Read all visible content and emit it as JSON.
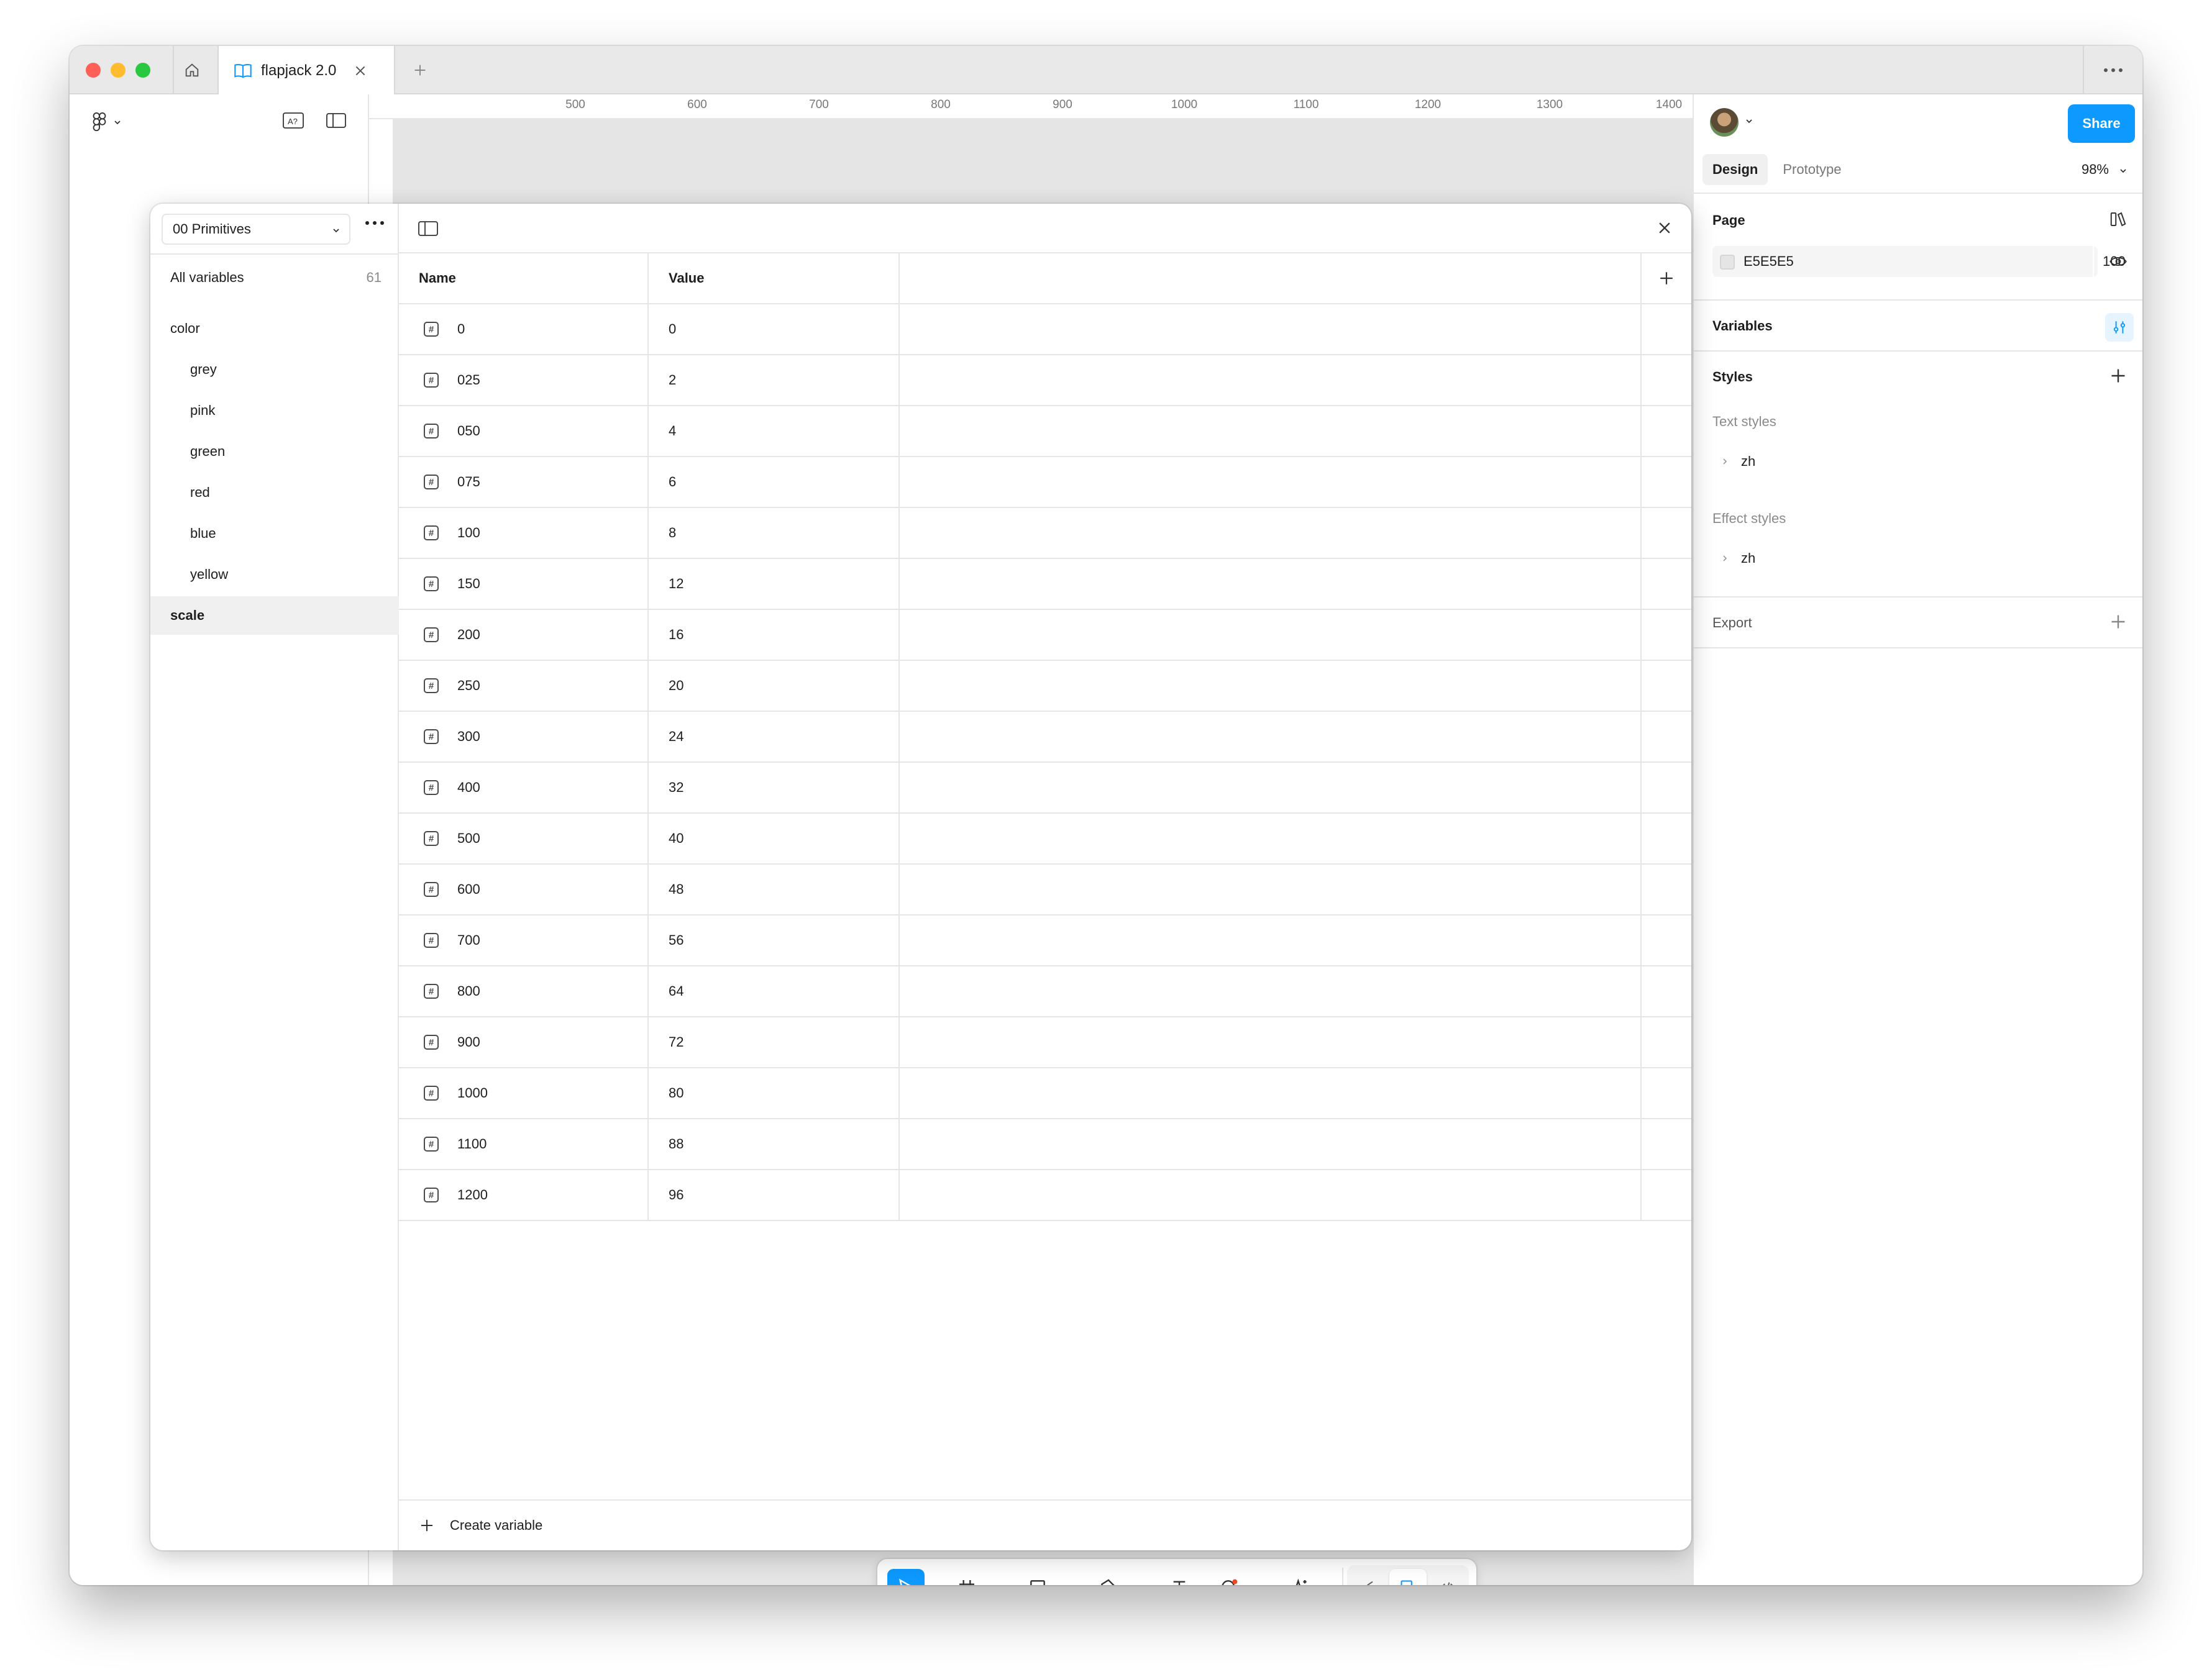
{
  "window": {
    "tab_title": "flapjack 2.0"
  },
  "ruler": {
    "ticks": [
      "500",
      "600",
      "700",
      "800",
      "900",
      "1000",
      "1100",
      "1200",
      "1300",
      "1400"
    ]
  },
  "right_panel": {
    "share_label": "Share",
    "tabs": [
      "Design",
      "Prototype"
    ],
    "zoom": "98%",
    "page_title": "Page",
    "page_color_hex": "E5E5E5",
    "page_opacity": "100",
    "page_opacity_unit": "%",
    "variables_title": "Variables",
    "styles_title": "Styles",
    "text_styles_label": "Text styles",
    "text_style_item": "zh",
    "effect_styles_label": "Effect styles",
    "effect_style_item": "zh",
    "export_title": "Export"
  },
  "help_label": "?",
  "variables_modal": {
    "collection": "00 Primitives",
    "all_variables_label": "All variables",
    "all_variables_count": "61",
    "groups": [
      "color",
      "grey",
      "pink",
      "green",
      "red",
      "blue",
      "yellow",
      "scale"
    ],
    "selected_group": "scale",
    "columns": [
      "Name",
      "Value"
    ],
    "rows": [
      {
        "name": "0",
        "value": "0"
      },
      {
        "name": "025",
        "value": "2"
      },
      {
        "name": "050",
        "value": "4"
      },
      {
        "name": "075",
        "value": "6"
      },
      {
        "name": "100",
        "value": "8"
      },
      {
        "name": "150",
        "value": "12"
      },
      {
        "name": "200",
        "value": "16"
      },
      {
        "name": "250",
        "value": "20"
      },
      {
        "name": "300",
        "value": "24"
      },
      {
        "name": "400",
        "value": "32"
      },
      {
        "name": "500",
        "value": "40"
      },
      {
        "name": "600",
        "value": "48"
      },
      {
        "name": "700",
        "value": "56"
      },
      {
        "name": "800",
        "value": "64"
      },
      {
        "name": "900",
        "value": "72"
      },
      {
        "name": "1000",
        "value": "80"
      },
      {
        "name": "1100",
        "value": "88"
      },
      {
        "name": "1200",
        "value": "96"
      }
    ],
    "create_label": "Create variable"
  },
  "colors": {
    "accent": "#0d99ff",
    "canvas": "#e5e5e5"
  }
}
